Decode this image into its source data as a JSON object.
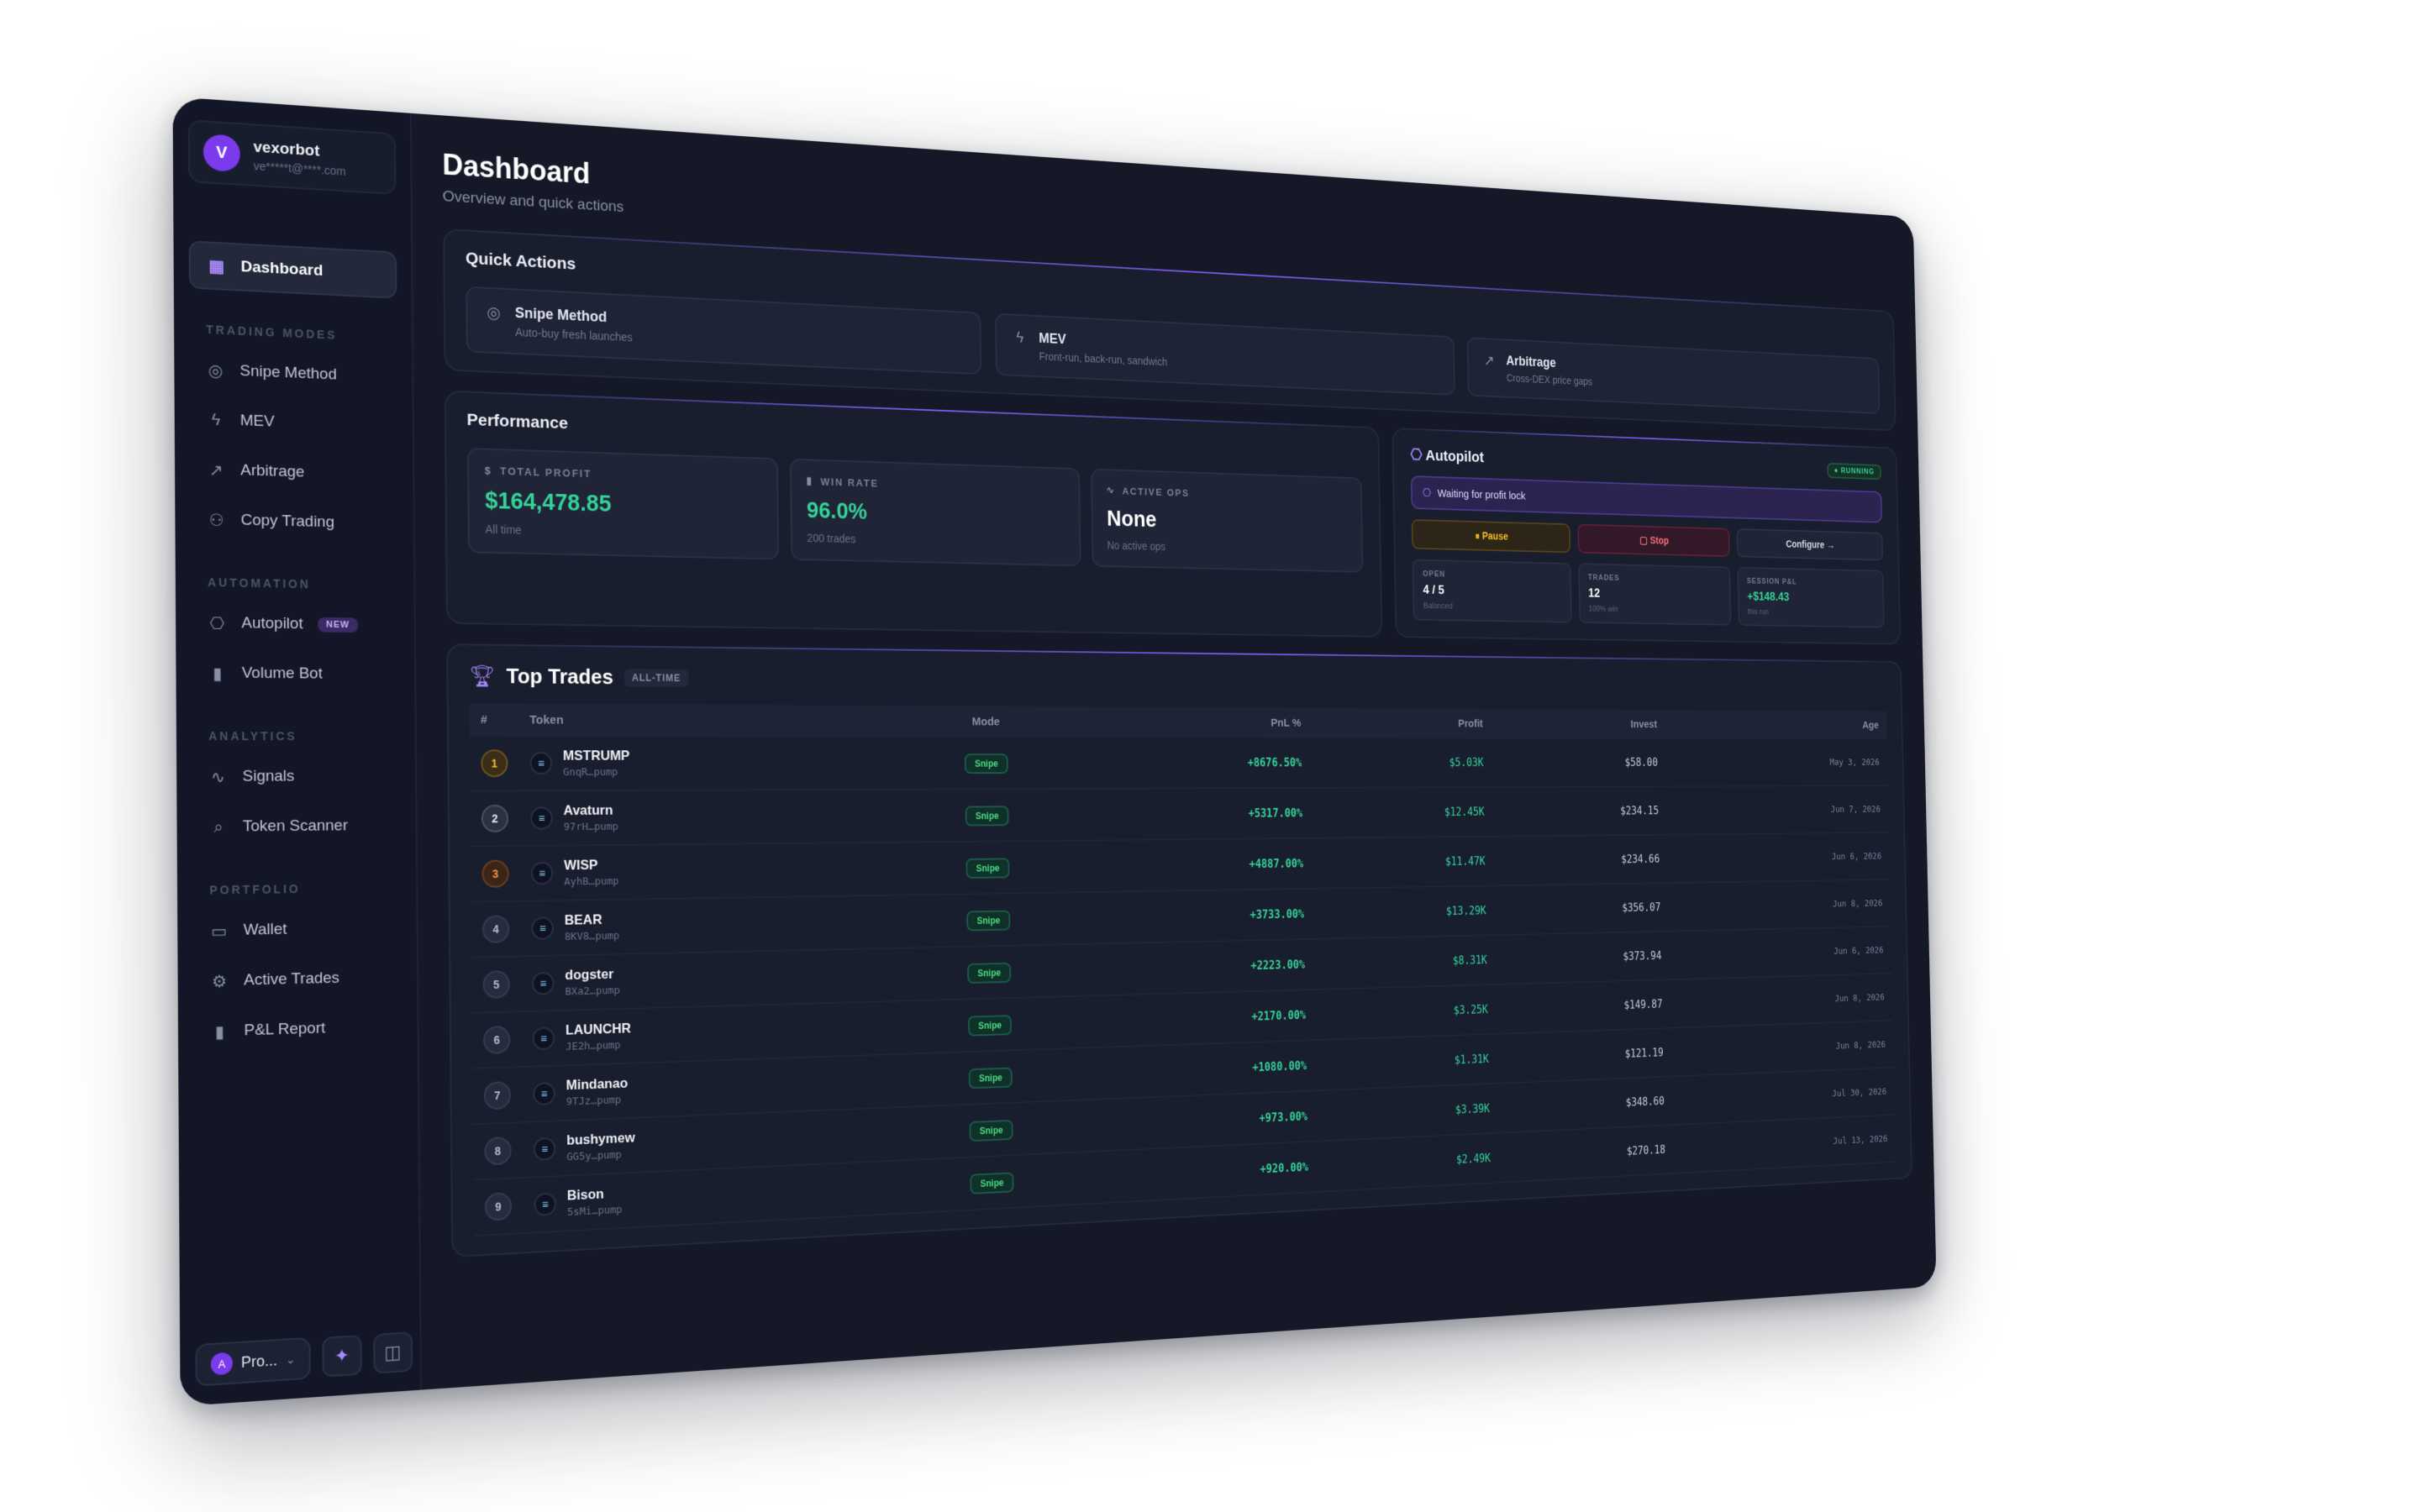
{
  "profile": {
    "initial": "V",
    "name": "vexorbot",
    "email": "ve*****t@****.com"
  },
  "nav": {
    "dashboard": "Dashboard",
    "sections": {
      "trading_modes": "TRADING MODES",
      "automation": "AUTOMATION",
      "analytics": "ANALYTICS",
      "portfolio": "PORTFOLIO"
    },
    "snipe": "Snipe Method",
    "mev": "MEV",
    "arbitrage": "Arbitrage",
    "copy": "Copy Trading",
    "autopilot": "Autopilot",
    "new_badge": "NEW",
    "volume": "Volume Bot",
    "signals": "Signals",
    "scanner": "Token Scanner",
    "wallet": "Wallet",
    "active_trades": "Active Trades",
    "pnl_report": "P&L Report"
  },
  "footer": {
    "plan": "Pro...",
    "plan_initial": "A"
  },
  "header": {
    "title": "Dashboard",
    "subtitle": "Overview and quick actions"
  },
  "quick_actions": {
    "title": "Quick Actions",
    "items": [
      {
        "label": "Snipe Method",
        "desc": "Auto-buy fresh launches"
      },
      {
        "label": "MEV",
        "desc": "Front-run, back-run, sandwich"
      },
      {
        "label": "Arbitrage",
        "desc": "Cross-DEX price gaps"
      }
    ]
  },
  "performance": {
    "title": "Performance",
    "total_profit": {
      "label": "TOTAL PROFIT",
      "value": "$164,478.85",
      "sub": "All time"
    },
    "win_rate": {
      "label": "WIN RATE",
      "value": "96.0%",
      "sub": "200 trades"
    },
    "active_ops": {
      "label": "ACTIVE OPS",
      "value": "None",
      "sub": "No active ops"
    }
  },
  "autopilot": {
    "title": "Autopilot",
    "badge": "● RUNNING",
    "status": "Waiting for profit lock",
    "pause": "Pause",
    "stop": "Stop",
    "configure": "Configure →",
    "open": {
      "label": "OPEN",
      "value": "4 / 5",
      "sub": "Balanced"
    },
    "trades": {
      "label": "TRADES",
      "value": "12",
      "sub": "100% win"
    },
    "session": {
      "label": "SESSION P&L",
      "value": "+$148.43",
      "sub": "this run"
    }
  },
  "top_trades": {
    "title": "Top Trades",
    "badge": "ALL-TIME",
    "columns": {
      "rank": "#",
      "token": "Token",
      "mode": "Mode",
      "pnl": "PnL %",
      "profit": "Profit",
      "invest": "Invest",
      "age": "Age"
    },
    "rows": [
      {
        "rank": "1",
        "name": "MSTRUMP",
        "addr": "GnqR…pump",
        "mode": "Snipe",
        "pnl": "+8676.50%",
        "profit": "$5.03K",
        "invest": "$58.00",
        "age": "May 3, 2026"
      },
      {
        "rank": "2",
        "name": "Avaturn",
        "addr": "97rH…pump",
        "mode": "Snipe",
        "pnl": "+5317.00%",
        "profit": "$12.45K",
        "invest": "$234.15",
        "age": "Jun 7, 2026"
      },
      {
        "rank": "3",
        "name": "WISP",
        "addr": "AyhB…pump",
        "mode": "Snipe",
        "pnl": "+4887.00%",
        "profit": "$11.47K",
        "invest": "$234.66",
        "age": "Jun 6, 2026"
      },
      {
        "rank": "4",
        "name": "BEAR",
        "addr": "8KV8…pump",
        "mode": "Snipe",
        "pnl": "+3733.00%",
        "profit": "$13.29K",
        "invest": "$356.07",
        "age": "Jun 8, 2026"
      },
      {
        "rank": "5",
        "name": "dogster",
        "addr": "BXa2…pump",
        "mode": "Snipe",
        "pnl": "+2223.00%",
        "profit": "$8.31K",
        "invest": "$373.94",
        "age": "Jun 6, 2026"
      },
      {
        "rank": "6",
        "name": "LAUNCHR",
        "addr": "JE2h…pump",
        "mode": "Snipe",
        "pnl": "+2170.00%",
        "profit": "$3.25K",
        "invest": "$149.87",
        "age": "Jun 8, 2026"
      },
      {
        "rank": "7",
        "name": "Mindanao",
        "addr": "9TJz…pump",
        "mode": "Snipe",
        "pnl": "+1080.00%",
        "profit": "$1.31K",
        "invest": "$121.19",
        "age": "Jun 8, 2026"
      },
      {
        "rank": "8",
        "name": "bushymew",
        "addr": "GG5y…pump",
        "mode": "Snipe",
        "pnl": "+973.00%",
        "profit": "$3.39K",
        "invest": "$348.60",
        "age": "Jul 30, 2026"
      },
      {
        "rank": "9",
        "name": "Bison",
        "addr": "5sMi…pump",
        "mode": "Snipe",
        "pnl": "+920.00%",
        "profit": "$2.49K",
        "invest": "$270.18",
        "age": "Jul 13, 2026"
      }
    ]
  }
}
